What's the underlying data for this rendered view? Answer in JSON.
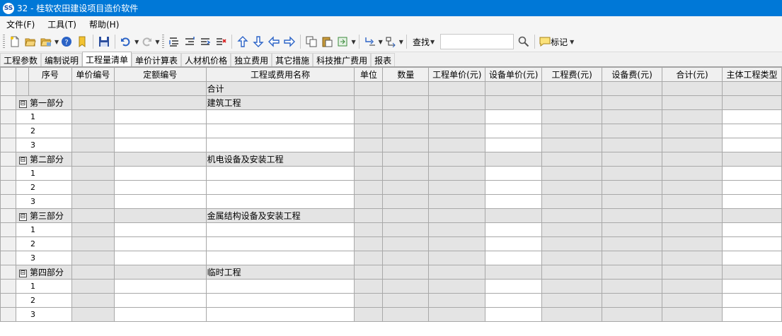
{
  "window": {
    "icon_text": "SS",
    "title": "32 - 桂软农田建设项目造价软件"
  },
  "menu": [
    {
      "label": "文件(F)"
    },
    {
      "label": "工具(T)"
    },
    {
      "label": "帮助(H)"
    }
  ],
  "toolbar": {
    "find_label": "查找",
    "find_value": "",
    "mark_label": "标记"
  },
  "tabs": [
    {
      "label": "工程参数",
      "active": false
    },
    {
      "label": "编制说明",
      "active": false
    },
    {
      "label": "工程量清单",
      "active": true
    },
    {
      "label": "单价计算表",
      "active": false
    },
    {
      "label": "人材机价格",
      "active": false
    },
    {
      "label": "独立费用",
      "active": false
    },
    {
      "label": "其它措施",
      "active": false
    },
    {
      "label": "科技推广费用",
      "active": false
    },
    {
      "label": "报表",
      "active": false
    }
  ],
  "grid": {
    "columns": [
      "序号",
      "单价编号",
      "定额编号",
      "工程或费用名称",
      "单位",
      "数量",
      "工程单价(元)",
      "设备单价(元)",
      "工程费(元)",
      "设备费(元)",
      "合计(元)",
      "主体工程类型"
    ],
    "total_label": "合计",
    "sections": [
      {
        "seq": "第一部分",
        "name": "建筑工程",
        "rows": [
          "1",
          "2",
          "3"
        ]
      },
      {
        "seq": "第二部分",
        "name": "机电设备及安装工程",
        "rows": [
          "1",
          "2",
          "3"
        ]
      },
      {
        "seq": "第三部分",
        "name": "金属结构设备及安装工程",
        "rows": [
          "1",
          "2",
          "3"
        ]
      },
      {
        "seq": "第四部分",
        "name": "临时工程",
        "rows": [
          "1",
          "2",
          "3"
        ]
      }
    ],
    "collapse_symbol": "⊟"
  }
}
